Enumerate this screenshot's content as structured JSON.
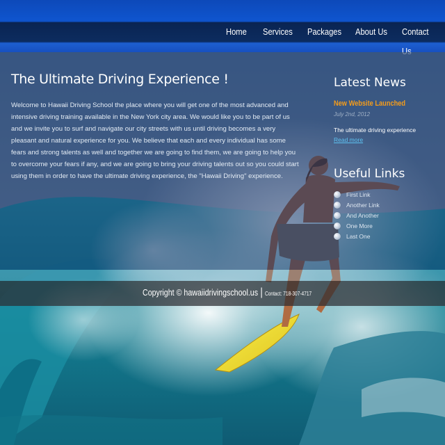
{
  "nav": {
    "items": [
      "Home",
      "Services",
      "Packages",
      "About Us",
      "Contact Us"
    ]
  },
  "main": {
    "heading": "The Ultimate Driving Experience !",
    "intro": "Welcome to Hawaii Driving School the place where you will get one of the most advanced and intensive driving training available in the New York city area. We would like you to be part of us and we invite you to surf and navigate our city streets with us until driving becomes a very pleasant and natural experience for you. We believe that each and every individual has some fears and strong talents as well and together we are going to find them, we are going to help you to overcome your fears if any, and we are going to bring your driving talents out so you could start using them in order to have the ultimate driving experience, the \"Hawaii Driving\" experience."
  },
  "news": {
    "heading": "Latest News",
    "title": "New Website Launched",
    "date": "July 2nd, 2012",
    "body": "The ultimate driving experience",
    "read_more": "Read more"
  },
  "links": {
    "heading": "Useful Links",
    "items": [
      "First Link",
      "Another Link",
      "And Another",
      "One More",
      "Last One"
    ]
  },
  "footer": {
    "copyright": "Copyright © hawaiidrivingschool.us",
    "separator": "|",
    "contact": "Contact: 718-307-4717"
  },
  "colors": {
    "nav_bar": "#0a2452",
    "accent_orange": "#f39c1c",
    "link_blue": "#5ec3f2"
  }
}
